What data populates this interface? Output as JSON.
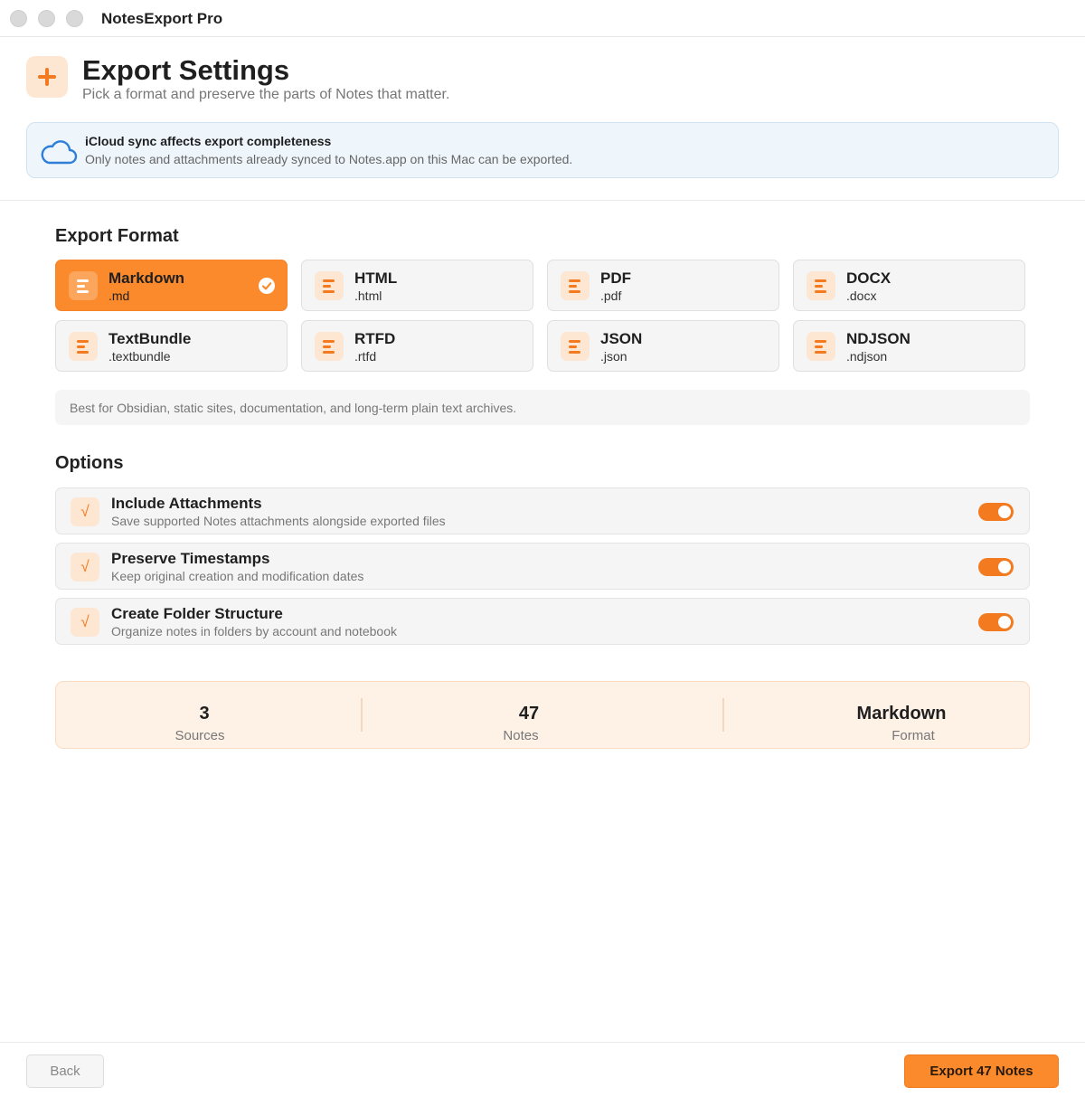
{
  "window": {
    "title": "NotesExport Pro"
  },
  "header": {
    "icon": "plus-icon",
    "title": "Export Settings",
    "subtitle": "Pick a format and preserve the parts of Notes that matter."
  },
  "banner": {
    "icon": "cloud-icon",
    "title": "iCloud sync affects export completeness",
    "text": "Only notes and attachments already synced to Notes.app on this Mac can be exported."
  },
  "formats": {
    "title": "Export Format",
    "selected": "Markdown",
    "items": [
      {
        "name": "Markdown",
        "ext": ".md"
      },
      {
        "name": "HTML",
        "ext": ".html"
      },
      {
        "name": "PDF",
        "ext": ".pdf"
      },
      {
        "name": "DOCX",
        "ext": ".docx"
      },
      {
        "name": "TextBundle",
        "ext": ".textbundle"
      },
      {
        "name": "RTFD",
        "ext": ".rtfd"
      },
      {
        "name": "JSON",
        "ext": ".json"
      },
      {
        "name": "NDJSON",
        "ext": ".ndjson"
      }
    ],
    "description": "Best for Obsidian, static sites, documentation, and long-term plain text archives."
  },
  "options": {
    "title": "Options",
    "items": [
      {
        "icon": "√",
        "title": "Include Attachments",
        "description": "Save supported Notes attachments alongside exported files",
        "enabled": true
      },
      {
        "icon": "√",
        "title": "Preserve Timestamps",
        "description": "Keep original creation and modification dates",
        "enabled": true
      },
      {
        "icon": "√",
        "title": "Create Folder Structure",
        "description": "Organize notes in folders by account and notebook",
        "enabled": true
      }
    ]
  },
  "summary": {
    "sources": {
      "value": "3",
      "label": "Sources"
    },
    "notes": {
      "value": "47",
      "label": "Notes"
    },
    "format": {
      "value": "Markdown",
      "label": "Format"
    }
  },
  "footer": {
    "back_label": "Back",
    "export_label": "Export 47 Notes"
  },
  "colors": {
    "accent": "#fb8a2c",
    "accent_soft": "#fde6d2",
    "info_bg": "#eef6fc",
    "info_icon": "#2f7fd8"
  }
}
